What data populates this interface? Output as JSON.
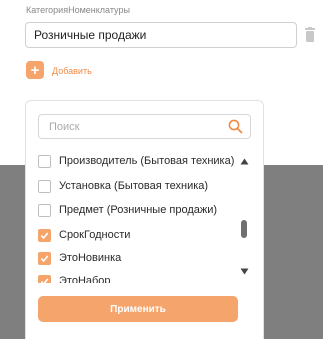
{
  "field": {
    "label": "КатегорияНоменклатуры",
    "value": "Розничные продажи"
  },
  "add": {
    "icon": "plus-icon",
    "label": "Добавить"
  },
  "filter": {
    "search_placeholder": "Поиск",
    "options": [
      {
        "label": "Производитель (Бытовая техника)",
        "checked": false
      },
      {
        "label": "Установка (Бытовая техника)",
        "checked": false
      },
      {
        "label": "Предмет (Розничные продажи)",
        "checked": false
      },
      {
        "label": "СрокГодности",
        "checked": true
      },
      {
        "label": "ЭтоНовинка",
        "checked": true
      },
      {
        "label": "ЭтоНабор",
        "checked": true
      }
    ],
    "apply_label": "Применить"
  },
  "colors": {
    "accent": "#f5a56b",
    "accent_text": "#f08c45",
    "overlay": "#7f7f7f"
  }
}
